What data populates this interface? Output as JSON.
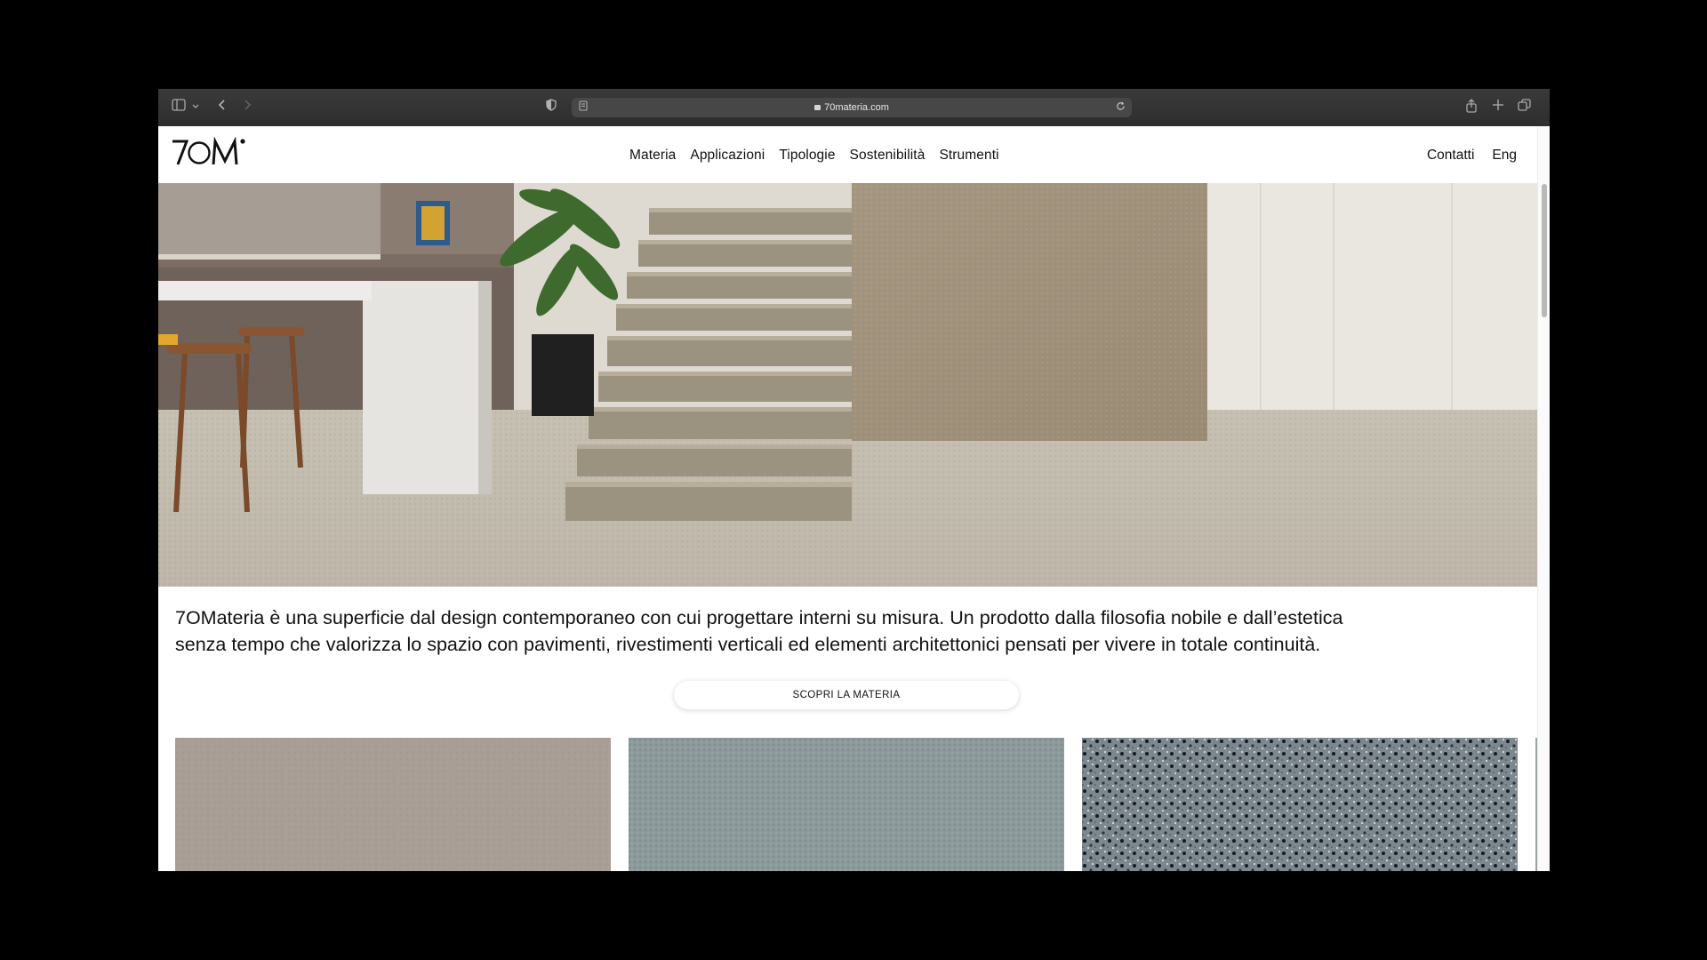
{
  "browser": {
    "url": "70materia.com",
    "icons": [
      "sidebar-icon",
      "chevron-down-icon",
      "back-icon",
      "forward-icon",
      "shield-icon",
      "page-icon",
      "lock-icon",
      "reload-icon",
      "share-icon",
      "new-tab-icon",
      "tabs-overview-icon"
    ]
  },
  "site": {
    "logo_text": "7OM",
    "nav": [
      "Materia",
      "Applicazioni",
      "Tipologie",
      "Sostenibilità",
      "Strumenti"
    ],
    "nav_right": [
      "Contatti",
      "Eng"
    ]
  },
  "intro": {
    "line1": "7OMateria è una superficie dal design contemporaneo con cui progettare interni su misura. Un prodotto dalla filosofia nobile e dall’estetica",
    "line2": "senza tempo che valorizza lo spazio con pavimenti, rivestimenti verticali ed elementi architettonici pensati per vivere in totale continuità."
  },
  "cta": {
    "label": "SCOPRI LA MATERIA"
  },
  "colors": {
    "window_bg": "#ffffff",
    "toolbar": "#333333",
    "text": "#111111"
  }
}
